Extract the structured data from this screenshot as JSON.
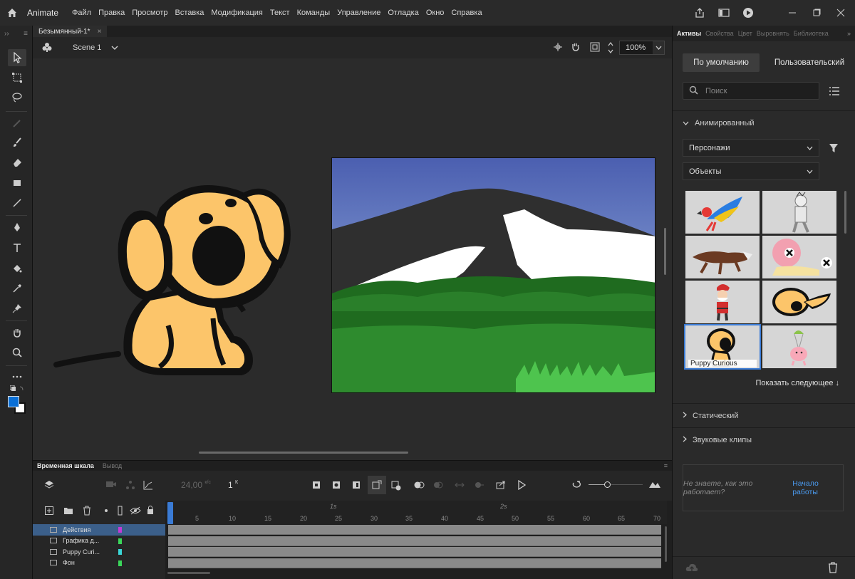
{
  "app": {
    "name": "Animate"
  },
  "menu": [
    "Файл",
    "Правка",
    "Просмотр",
    "Вставка",
    "Модификация",
    "Текст",
    "Команды",
    "Управление",
    "Отладка",
    "Окно",
    "Справка"
  ],
  "document": {
    "tab_title": "Безымянный-1*",
    "scene": "Scene 1",
    "zoom": "100%"
  },
  "timeline": {
    "tabs": {
      "active": "Временная шкала",
      "inactive": "Вывод"
    },
    "fps": "24,00",
    "fps_unit": "к/с",
    "frame": "1",
    "frame_unit": "К",
    "ruler_numbers": [
      "5",
      "10",
      "15",
      "20",
      "25",
      "30",
      "35",
      "40",
      "45",
      "50",
      "55",
      "60",
      "65",
      "70"
    ],
    "ruler_seconds": [
      "1s",
      "2s"
    ],
    "layers": [
      {
        "name": "Действия",
        "color": "#c43ad6",
        "selected": true
      },
      {
        "name": "Графика д...",
        "color": "#3ad65a",
        "selected": false
      },
      {
        "name": "Puppy Curi...",
        "color": "#3ad6d6",
        "selected": false
      },
      {
        "name": "Фон",
        "color": "#3ad65a",
        "selected": false
      }
    ]
  },
  "panel": {
    "tabs": {
      "active": "Активы",
      "others": [
        "Свойства",
        "Цвет",
        "Выровнять",
        "Библиотека"
      ]
    },
    "segment_default": "По умолчанию",
    "segment_custom": "Пользовательский",
    "search_placeholder": "Поиск",
    "section_animated": "Анимированный",
    "filter_characters": "Персонажи",
    "filter_objects": "Объекты",
    "selected_asset_caption": "Puppy Curious",
    "show_next": "Показать следующее ↓",
    "section_static": "Статический",
    "section_sound": "Звуковые клипы",
    "help_question": "Не знаете, как это работает?",
    "help_link": "Начало работы"
  },
  "colors": {
    "accent": "#3a7bd5",
    "fill_color": "#0a6fd6",
    "stroke_color": "#ffffff"
  }
}
